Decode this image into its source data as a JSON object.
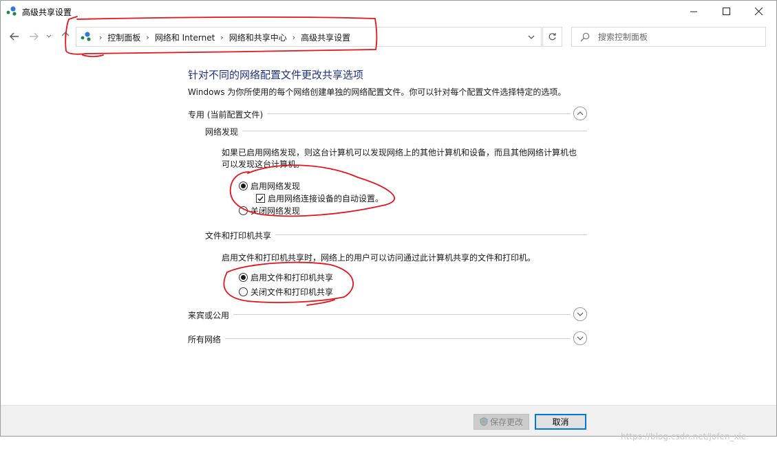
{
  "window": {
    "title": "高级共享设置",
    "controls": {
      "minimize": "—",
      "maximize": "☐",
      "close": "✕"
    }
  },
  "nav": {
    "back_icon": "arrow-left",
    "forward_icon": "arrow-right",
    "recent_icon": "chevron-down",
    "up_icon": "arrow-up",
    "breadcrumbs": [
      "控制面板",
      "网络和 Internet",
      "网络和共享中心",
      "高级共享设置"
    ],
    "search_placeholder": "搜索控制面板"
  },
  "main": {
    "heading": "针对不同的网络配置文件更改共享选项",
    "description": "Windows 为你所使用的每个网络创建单独的网络配置文件。你可以针对每个配置文件选择特定的选项。",
    "profile_private": {
      "label": "专用 (当前配置文件)",
      "expanded": true,
      "network_discovery": {
        "label": "网络发现",
        "text": "如果已启用网络发现，则这台计算机可以发现网络上的其他计算机和设备，而且其他网络计算机也可以发现这台计算机。",
        "text_line1": "如果已启用网络发现，则这台计算机可以发现网络上的其他计算机和设备，而且其他网络计算机也",
        "text_line2": "可以发现这台计算机。",
        "opt_on": "启用网络发现",
        "opt_on_selected": true,
        "auto_setup": "启用网络连接设备的自动设置。",
        "auto_setup_checked": true,
        "opt_off": "关闭网络发现"
      },
      "file_sharing": {
        "label": "文件和打印机共享",
        "text": "启用文件和打印机共享时，网络上的用户可以访问通过此计算机共享的文件和打印机。",
        "opt_on": "启用文件和打印机共享",
        "opt_on_selected": true,
        "opt_off": "关闭文件和打印机共享"
      }
    },
    "profile_guest": {
      "label": "来宾或公用",
      "expanded": false
    },
    "profile_all": {
      "label": "所有网络",
      "expanded": false
    }
  },
  "footer": {
    "save_label": "保存更改",
    "cancel_label": "取消"
  },
  "watermark": "https://blog.csdn.net/Jofen_xie",
  "colors": {
    "heading": "#1e3287",
    "accent": "#0078d7",
    "annotation": "#e8121b"
  }
}
